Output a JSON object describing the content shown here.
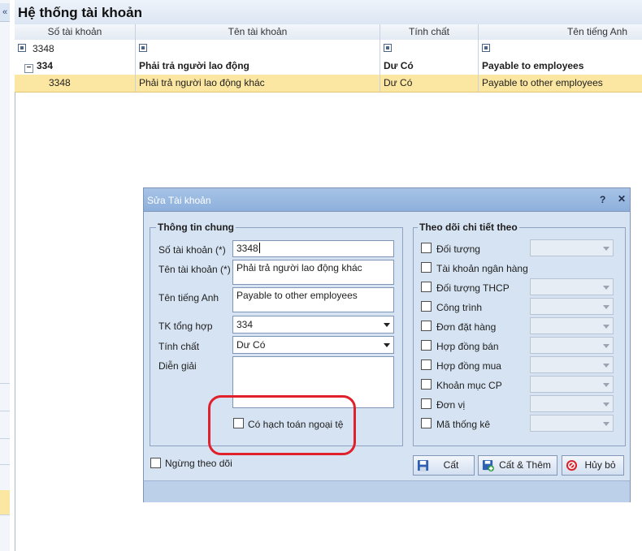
{
  "main": {
    "collapse_icon": "«",
    "title": "Hệ thống tài khoản",
    "columns": [
      "Số tài khoản",
      "Tên tài khoản",
      "Tính chất",
      "Tên tiếng Anh"
    ],
    "filter_value": "3348",
    "group_row": {
      "expander": "−",
      "account": "334",
      "name": "Phải trả người lao động",
      "nature": "Dư Có",
      "english": "Payable to employees"
    },
    "selected_row": {
      "account": "3348",
      "name": "Phải trả người lao động khác",
      "nature": "Dư Có",
      "english": "Payable to other employees"
    }
  },
  "dialog": {
    "title": "Sửa Tài khoản",
    "help_label": "?",
    "close_label": "✕",
    "general_section": "Thông tin chung",
    "fields": {
      "account_no_label": "Số tài khoản (*)",
      "account_no_value": "3348",
      "account_name_label": "Tên tài khoản (*)",
      "account_name_value": "Phải trả người lao động khác",
      "english_label": "Tên tiếng Anh",
      "english_value": "Payable to other employees",
      "parent_label": "TK tổng hợp",
      "parent_value": "334",
      "nature_label": "Tính chất",
      "nature_value": "Dư Có",
      "description_label": "Diễn giải",
      "foreign_currency_label": "Có hạch toán ngoại tệ",
      "inactive_label": "Ngừng theo dõi"
    },
    "tracking_section": "Theo dõi chi tiết theo",
    "tracking_items": [
      {
        "label": "Đối tượng",
        "has_combo": true
      },
      {
        "label": "Tài khoản ngân hàng",
        "has_combo": false
      },
      {
        "label": "Đối tượng THCP",
        "has_combo": true
      },
      {
        "label": "Công trình",
        "has_combo": true
      },
      {
        "label": "Đơn đặt hàng",
        "has_combo": true
      },
      {
        "label": "Hợp đồng bán",
        "has_combo": true
      },
      {
        "label": "Hợp đồng mua",
        "has_combo": true
      },
      {
        "label": "Khoản mục CP",
        "has_combo": true
      },
      {
        "label": "Đơn vị",
        "has_combo": true
      },
      {
        "label": "Mã thống kê",
        "has_combo": true
      }
    ],
    "buttons": {
      "save": "Cất",
      "save_new": "Cất & Thêm",
      "cancel": "Hủy bỏ"
    },
    "icons": {
      "save": "floppy-disk-icon",
      "save_new": "save-add-icon",
      "cancel": "cancel-circle-icon"
    },
    "highlight_color": "#e0202b"
  }
}
